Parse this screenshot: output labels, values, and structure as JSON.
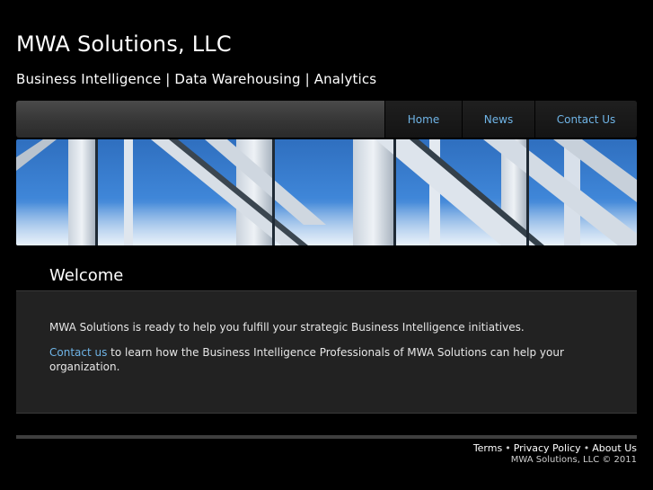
{
  "header": {
    "site_title": "MWA Solutions, LLC",
    "tagline": "Business Intelligence | Data Warehousing | Analytics"
  },
  "nav": {
    "items": [
      {
        "label": "Home"
      },
      {
        "label": "News"
      },
      {
        "label": "Contact Us"
      }
    ]
  },
  "banner": {
    "description_icon": "building-glass-facade-image"
  },
  "main": {
    "heading": "Welcome",
    "intro": "MWA Solutions is ready to help you fulfill your strategic Business Intelligence initiatives.",
    "contact_link": "Contact us",
    "contact_text": " to learn how the Business Intelligence Professionals of MWA Solutions can help your organization."
  },
  "footer": {
    "links": [
      {
        "label": "Terms"
      },
      {
        "label": "Privacy Policy"
      },
      {
        "label": "About Us"
      }
    ],
    "separator": "•",
    "copyright": "MWA Solutions, LLC © 2011"
  },
  "colors": {
    "background": "#000000",
    "link": "#6fb4e6",
    "content_panel": "#222222",
    "navbar": "#3a3a3a"
  }
}
